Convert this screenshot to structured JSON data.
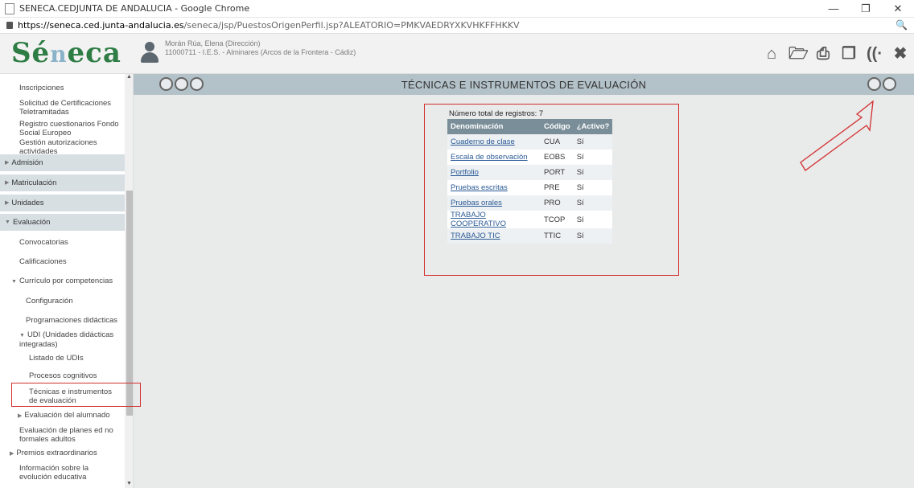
{
  "browser": {
    "window_title": "SENECA.CEDJUNTA DE ANDALUCIA - Google Chrome",
    "url_host": "https://seneca.ced.junta-andalucia.es",
    "url_path": "/seneca/jsp/PuestosOrigenPerfil.jsp?ALEATORIO=PMKVAEDRYXKVHKFFHKKV",
    "minimize": "—",
    "maximize": "❐",
    "close": "✕",
    "zoom_glyph": "🔍"
  },
  "header": {
    "logo_pre": "Sé",
    "logo_n": "n",
    "logo_post": "eca",
    "user_name": "Morán Rúa, Elena (Dirección)",
    "user_center": "11000711 - I.E.S. - Alminares (Arcos de la Frontera - Cádiz)"
  },
  "sidebar": {
    "items": [
      {
        "label": "Inscripciones",
        "type": "leaf"
      },
      {
        "label": "Solicitud de Certificaciones Teletramitadas",
        "type": "leaf"
      },
      {
        "label": "Registro cuestionarios Fondo Social Europeo",
        "type": "leaf"
      },
      {
        "label": "Gestión autorizaciones actividades",
        "type": "leaf"
      },
      {
        "label": "Admisión",
        "type": "group"
      },
      {
        "label": "Matriculación",
        "type": "group"
      },
      {
        "label": "Unidades",
        "type": "group"
      },
      {
        "label": "Evaluación",
        "type": "group"
      },
      {
        "label": "Convocatorias",
        "type": "leaf"
      },
      {
        "label": "Calificaciones",
        "type": "leaf"
      },
      {
        "label": "Currículo por competencias",
        "type": "leaf"
      },
      {
        "label": "Configuración",
        "type": "leaf"
      },
      {
        "label": "Programaciones didácticas",
        "type": "leaf"
      },
      {
        "label": "UDI (Unidades didácticas integradas)",
        "type": "leaf"
      },
      {
        "label": "Listado de UDIs",
        "type": "leaf"
      },
      {
        "label": "Procesos cognitivos",
        "type": "leaf"
      },
      {
        "label": "Técnicas e instrumentos de evaluación",
        "type": "leaf"
      },
      {
        "label": "Evaluación del alumnado",
        "type": "leaf"
      },
      {
        "label": "Evaluación de planes ed no formales adultos",
        "type": "leaf"
      },
      {
        "label": "Premios extraordinarios",
        "type": "leaf"
      },
      {
        "label": "Información sobre la evolución educativa",
        "type": "leaf"
      }
    ]
  },
  "toolbar": {
    "title": "TÉCNICAS E INSTRUMENTOS DE EVALUACIÓN"
  },
  "content": {
    "records_label": "Número total de registros: 7",
    "columns": [
      "Denominación",
      "Código",
      "¿Activo?"
    ],
    "rows": [
      {
        "name": "Cuaderno de clase",
        "code": "CUA",
        "active": "Sí"
      },
      {
        "name": "Escala de observación",
        "code": "EOBS",
        "active": "Sí"
      },
      {
        "name": "Portfolio",
        "code": "PORT",
        "active": "Sí"
      },
      {
        "name": "Pruebas escritas",
        "code": "PRE",
        "active": "Sí"
      },
      {
        "name": "Pruebas orales",
        "code": "PRO",
        "active": "Sí"
      },
      {
        "name": "TRABAJO COOPERATIVO",
        "code": "TCOP",
        "active": "Sí"
      },
      {
        "name": "TRABAJO TIC",
        "code": "TTIC",
        "active": "Sí"
      }
    ]
  },
  "colors": {
    "accent": "#2e7d45",
    "toolbar": "#b3c1c8",
    "table_header": "#7a8e99",
    "annotation": "#d32f2f"
  }
}
